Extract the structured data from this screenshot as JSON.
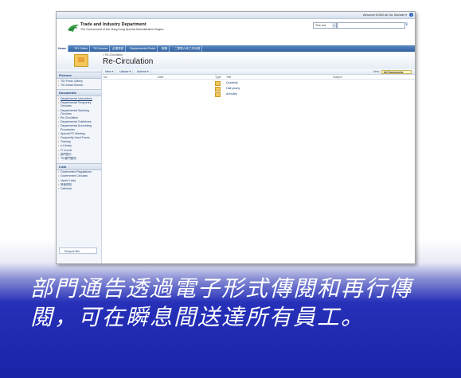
{
  "site": {
    "welcome": "Welcome KONG Ah Ha, Michelle ▾",
    "title": "Trade and Industry Department",
    "subtitle": "The Government of the Hong Kong Special Administrative Region",
    "search_scope": "This List"
  },
  "tabs": [
    "Home",
    "TID Online",
    "TID Access",
    "企業資訊",
    "Departmental Portal",
    "服務",
    "二零零九年工作計劃"
  ],
  "page": {
    "breadcrumb": "> Re-Circulation",
    "title": "Re-Circulation"
  },
  "leftnav": {
    "pictures_head": "Pictures",
    "pictures": [
      "TID Photo Gallery",
      "TID Admin Branch"
    ],
    "documents_head": "Documents",
    "documents": [
      "Departmental Instructions",
      "Departmental Temporary Circulars",
      "Departmental Standing Circulars",
      "Re-Circulation",
      "Departmental Guidelines",
      "Departmental Accounting Procedures",
      "Special PC Meeting",
      "Frequently Used Forms",
      "Training",
      "e-Library",
      "IT Corner",
      "部門簡介",
      "TID部門簡訊"
    ],
    "lists_head": "Lists",
    "lists": [
      "Government Regulations",
      "Government Circulars",
      "Useful Links",
      "其他資訊",
      "Calendar"
    ],
    "recycle": "Recycle Bin"
  },
  "toolbar": {
    "new": "New ▾",
    "upload": "Upload ▾",
    "actions": "Actions ▾",
    "view_label": "View:",
    "view_value": "All Documents"
  },
  "list": {
    "headers": {
      "no": "No.",
      "date": "Date",
      "type": "Type",
      "title": "Title",
      "subject": "Subject"
    },
    "rows": [
      "Quarterly",
      "Half-yearly",
      "Annually"
    ]
  },
  "caption": "部門通告透過電子形式傳閱和再行傳閱，可在瞬息間送達所有員工。"
}
